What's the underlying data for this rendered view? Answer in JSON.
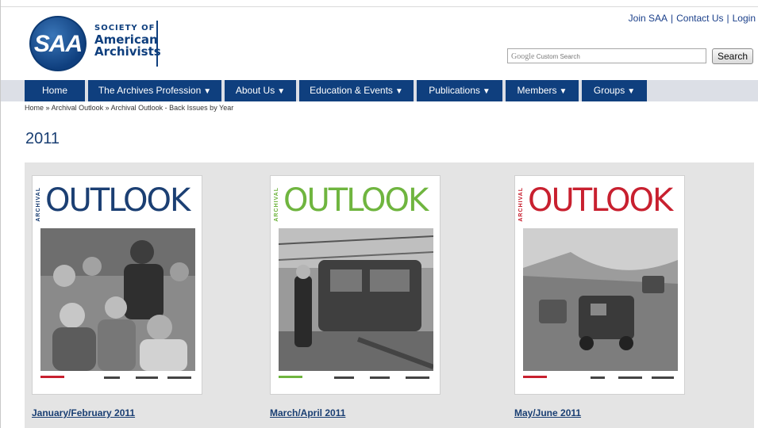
{
  "header": {
    "logo_abbr": "SAA",
    "logo_line1": "SOCIETY OF",
    "logo_line2": "American",
    "logo_line3": "Archivists",
    "top_links": [
      "Join SAA",
      "Contact Us",
      "Login"
    ],
    "search_brand": "Google",
    "search_placeholder": "Custom Search",
    "search_button": "Search"
  },
  "nav": {
    "items": [
      {
        "label": "Home",
        "dropdown": false
      },
      {
        "label": "The Archives Profession",
        "dropdown": true
      },
      {
        "label": "About Us",
        "dropdown": true
      },
      {
        "label": "Education & Events",
        "dropdown": true
      },
      {
        "label": "Publications",
        "dropdown": true
      },
      {
        "label": "Members",
        "dropdown": true
      },
      {
        "label": "Groups",
        "dropdown": true
      }
    ],
    "caret_icon": "caret-down-icon"
  },
  "breadcrumb": {
    "items": [
      "Home",
      "Archival Outlook",
      "Archival Outlook - Back Issues by Year"
    ],
    "separator": "»"
  },
  "page": {
    "title": "2011"
  },
  "issues": [
    {
      "cover_side": "ARCHIVAL",
      "cover_title": "OUTLOOK",
      "title_color": "#1b3f73",
      "link": "January/February 2011"
    },
    {
      "cover_side": "ARCHIVAL",
      "cover_title": "OUTLOOK",
      "title_color": "#6fb53f",
      "link": "March/April 2011"
    },
    {
      "cover_side": "ARCHIVAL",
      "cover_title": "OUTLOOK",
      "title_color": "#c8202f",
      "link": "May/June 2011"
    }
  ],
  "colors": {
    "brand_blue": "#0f3f7e",
    "link_blue": "#1a3f73",
    "content_bg": "#e4e4e4"
  }
}
